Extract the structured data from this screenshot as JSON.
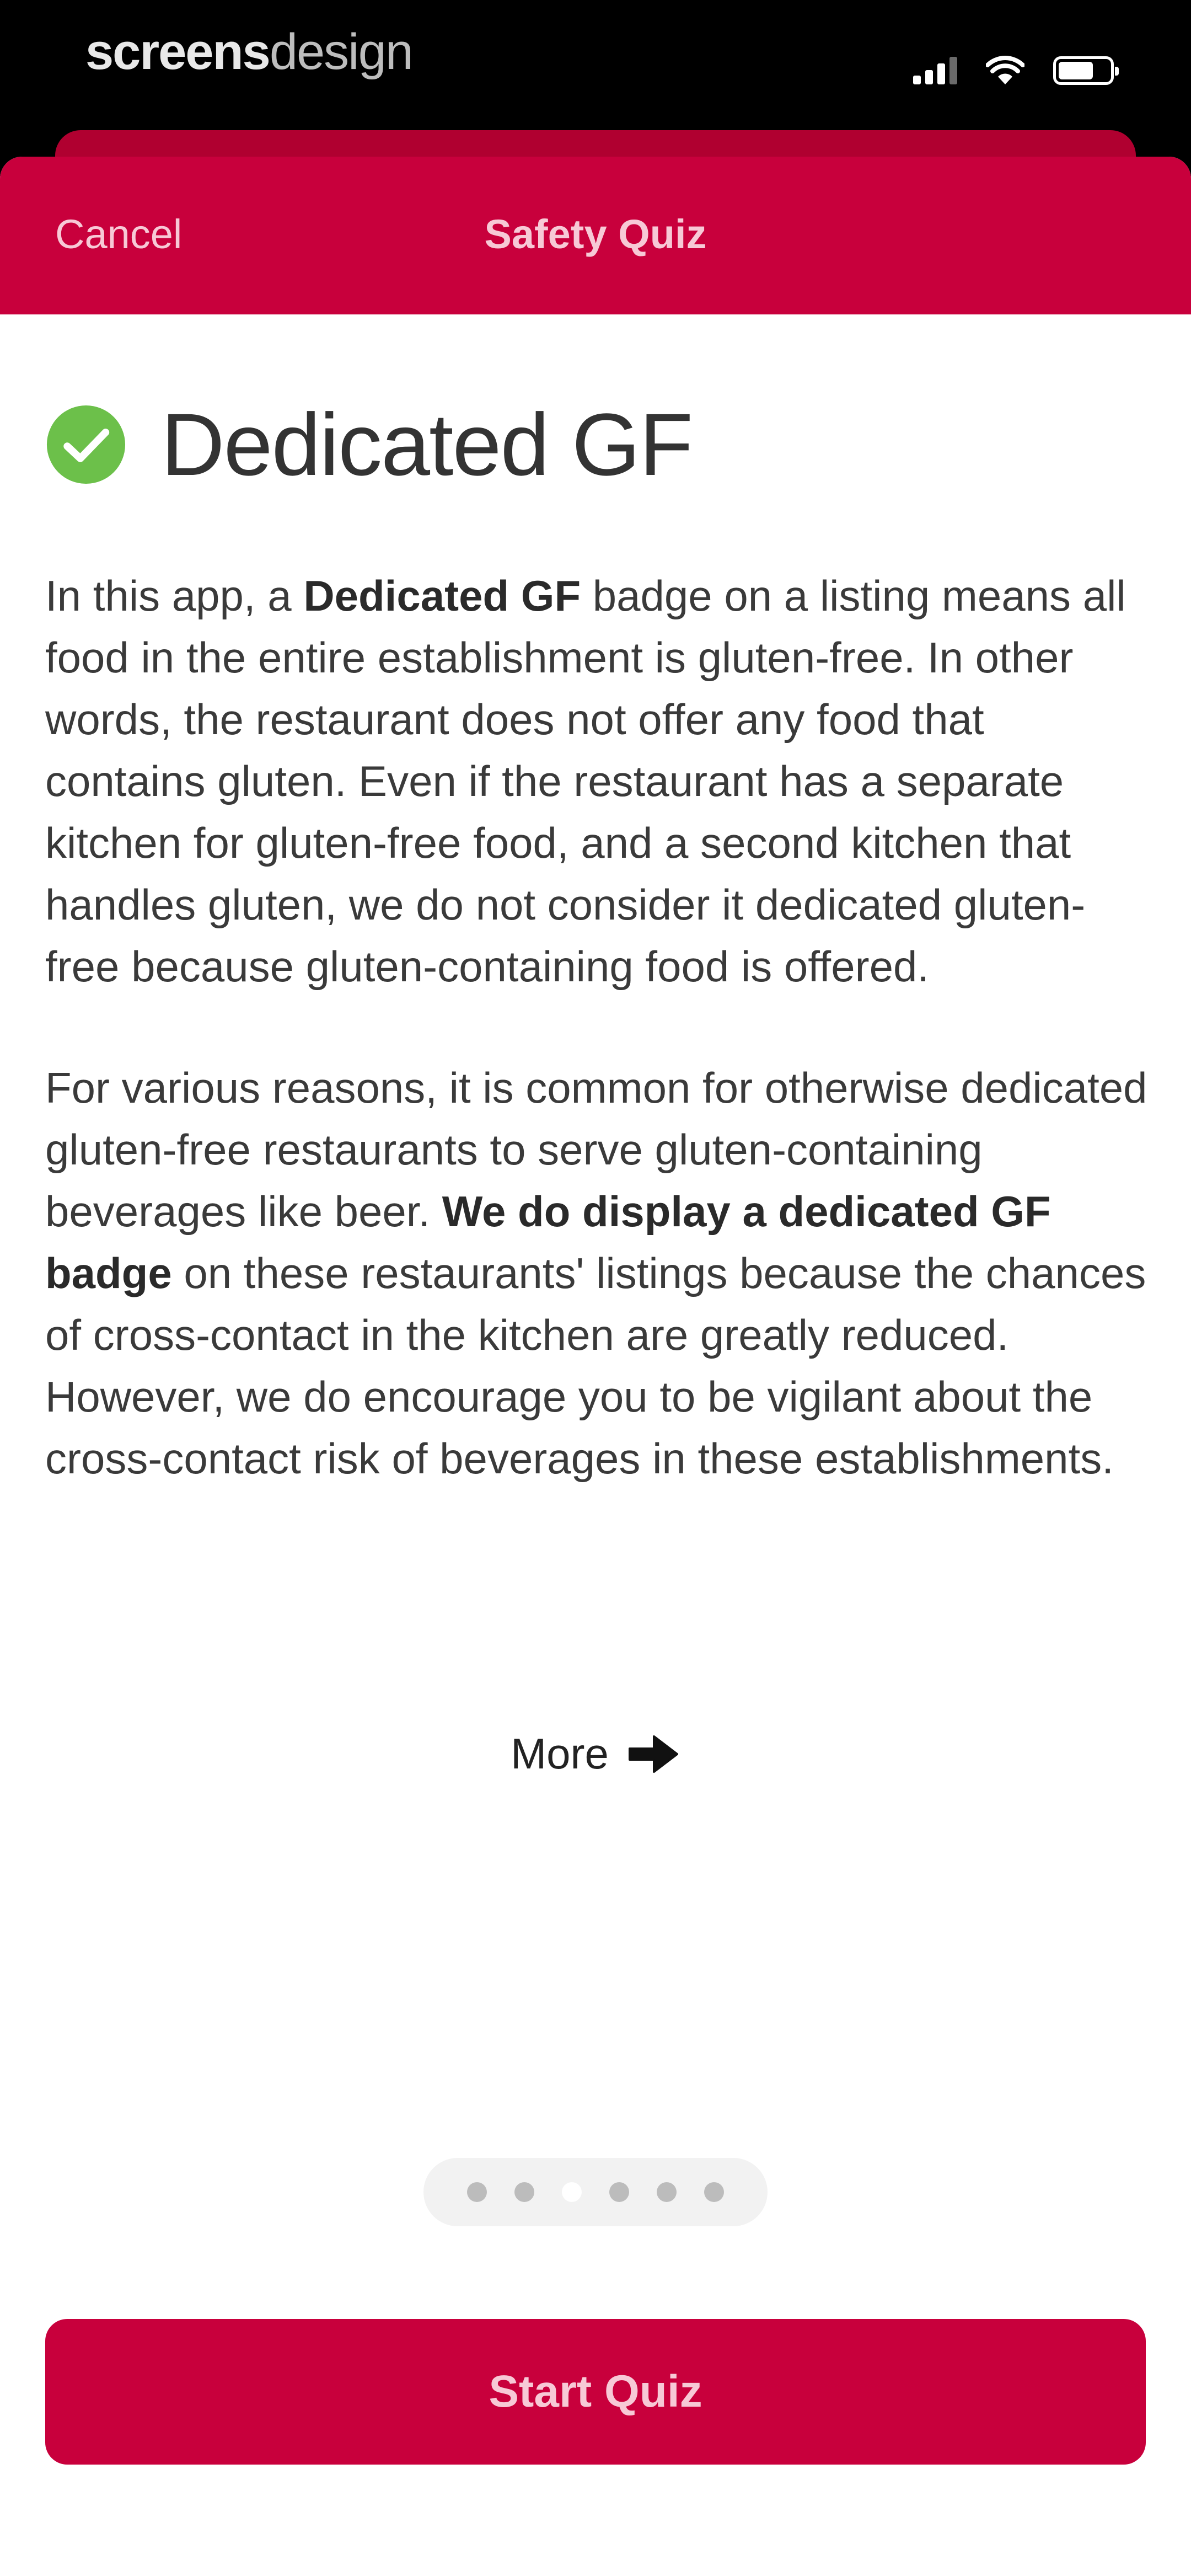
{
  "status_bar": {
    "watermark_bold": "screens",
    "watermark_light": "design",
    "icons": [
      "cellular-signal-icon",
      "wifi-icon",
      "battery-icon"
    ]
  },
  "nav": {
    "cancel_label": "Cancel",
    "title": "Safety Quiz"
  },
  "content": {
    "check_icon": "check-circle-icon",
    "title": "Dedicated GF",
    "paragraph1": {
      "p1": "In this app, a ",
      "b1": "Dedicated GF",
      "p2": " badge on a listing means all food in the entire establishment is gluten-free. In other words, the restaurant does not offer any food that contains gluten. Even if the restaurant has a separate kitchen for gluten-free food, and a second kitchen that handles gluten, we do not consider it dedicated gluten-free because gluten-containing food is offered."
    },
    "paragraph2": {
      "p1": "For various reasons, it is common for otherwise dedicated gluten-free restaurants to serve gluten-containing beverages like beer. ",
      "b1": "We do display a dedicated GF badge",
      "p2": " on these restaurants' listings because the chances of cross-contact in the kitchen are greatly reduced. However, we do encourage you to be vigilant about the cross-contact risk of beverages in these establishments."
    },
    "more_label": "More",
    "more_icon": "arrow-right-icon"
  },
  "pager": {
    "page_count": 6,
    "current_page": 3
  },
  "colors": {
    "brand": "#c8003c",
    "brand_text": "#f7c9d6",
    "check": "#6cc04a"
  },
  "footer": {
    "start_label": "Start Quiz"
  }
}
